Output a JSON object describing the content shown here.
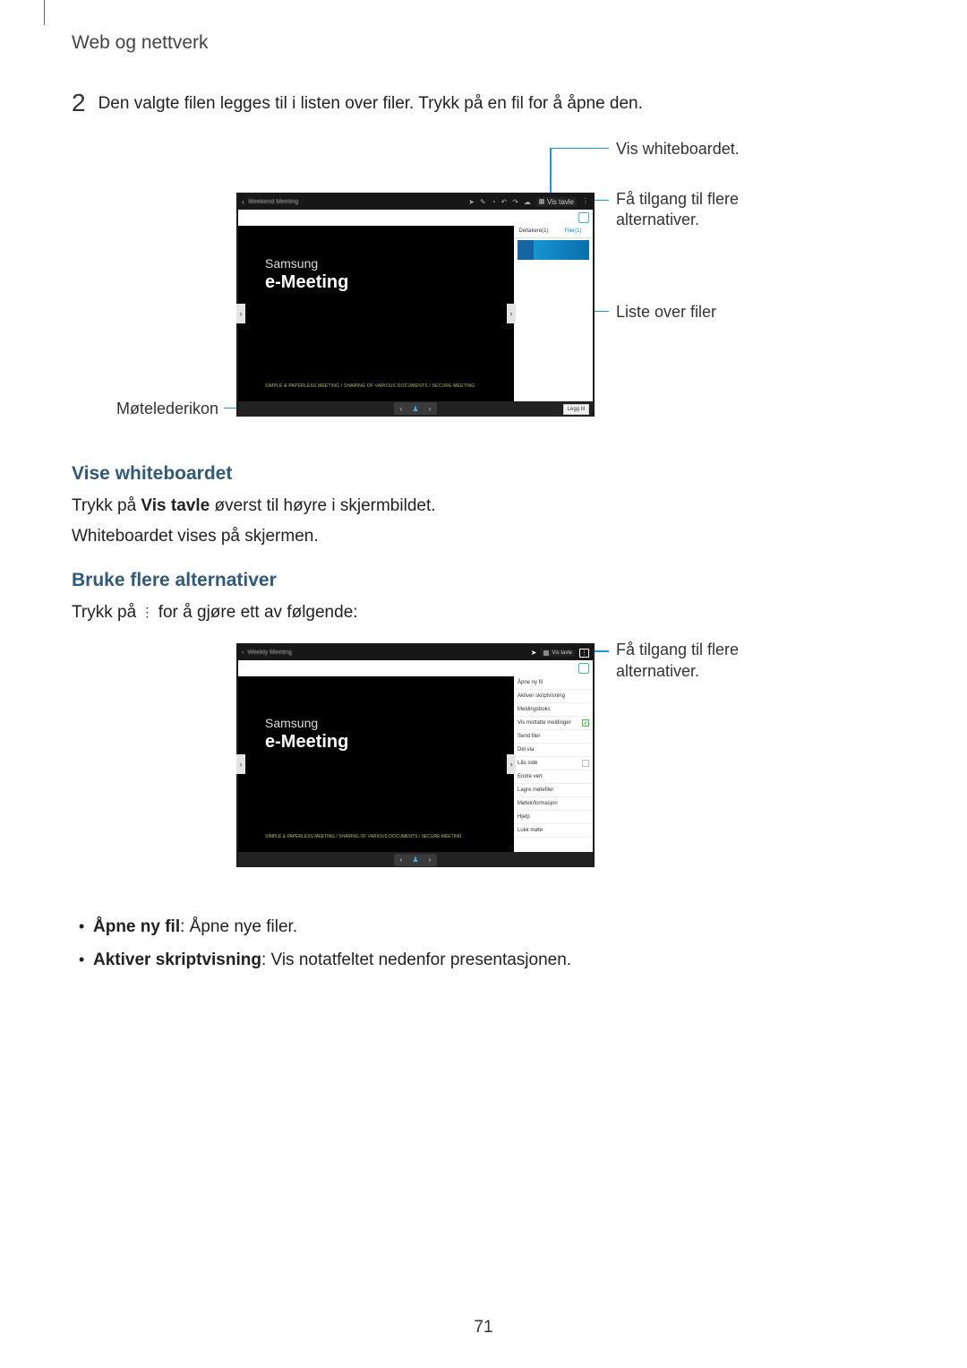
{
  "header": {
    "title": "Web og nettverk"
  },
  "step": {
    "number": "2",
    "text": "Den valgte filen legges til i listen over filer. Trykk på en fil for å åpne den."
  },
  "fig1": {
    "meeting_title": "Weekend Meeting",
    "vistavle_label": "Vis tavle",
    "tabs": {
      "participants": "Deltakere(1)",
      "files": "Filer(1)"
    },
    "slide": {
      "brand1": "Samsung",
      "brand2": "e-Meeting",
      "tiny": "SIMPLE & PAPERLESS MEETING / SHARING OF VARIOUS DOCUMENTS / SECURE MEETING"
    },
    "add_label": "Legg til",
    "callouts": {
      "whiteboard": "Vis whiteboardet.",
      "more1": "Få tilgang til flere",
      "more2": "alternativer.",
      "files": "Liste over filer",
      "leader": "Møtelederikon"
    }
  },
  "section_view_wb": {
    "heading": "Vise whiteboardet",
    "p1a": "Trykk på ",
    "p1b": "Vis tavle",
    "p1c": " øverst til høyre i skjermbildet.",
    "p2": "Whiteboardet vises på skjermen."
  },
  "section_more": {
    "heading": "Bruke flere alternativer",
    "p1a": "Trykk på ",
    "p1b": " for å gjøre ett av følgende:"
  },
  "fig2": {
    "meeting_title": "Weekly Meeting",
    "vistavle_label": "Vis tavle",
    "slide": {
      "brand1": "Samsung",
      "brand2": "e-Meeting",
      "tiny": "SIMPLE & PAPERLESS MEETING / SHARING OF VARIOUS DOCUMENTS / SECURE MEETING"
    },
    "menu": {
      "m0": "Åpne ny fil",
      "m1": "Aktiver skriptvisning",
      "m2": "Meldingsboks",
      "m3": "Vis mottatte meldinger",
      "m4": "Send filer",
      "m5": "Del via",
      "m6": "Lås side",
      "m7": "Endre vert",
      "m8": "Lagre møtefiler",
      "m9": "Møteinformasjon",
      "m10": "Hjelp",
      "m11": "Lukk møte"
    },
    "callouts": {
      "more1": "Få tilgang til flere",
      "more2": "alternativer."
    }
  },
  "bullets": {
    "b1a": "Åpne ny fil",
    "b1b": ": Åpne nye filer.",
    "b2a": "Aktiver skriptvisning",
    "b2b": ": Vis notatfeltet nedenfor presentasjonen."
  },
  "page_number": "71"
}
